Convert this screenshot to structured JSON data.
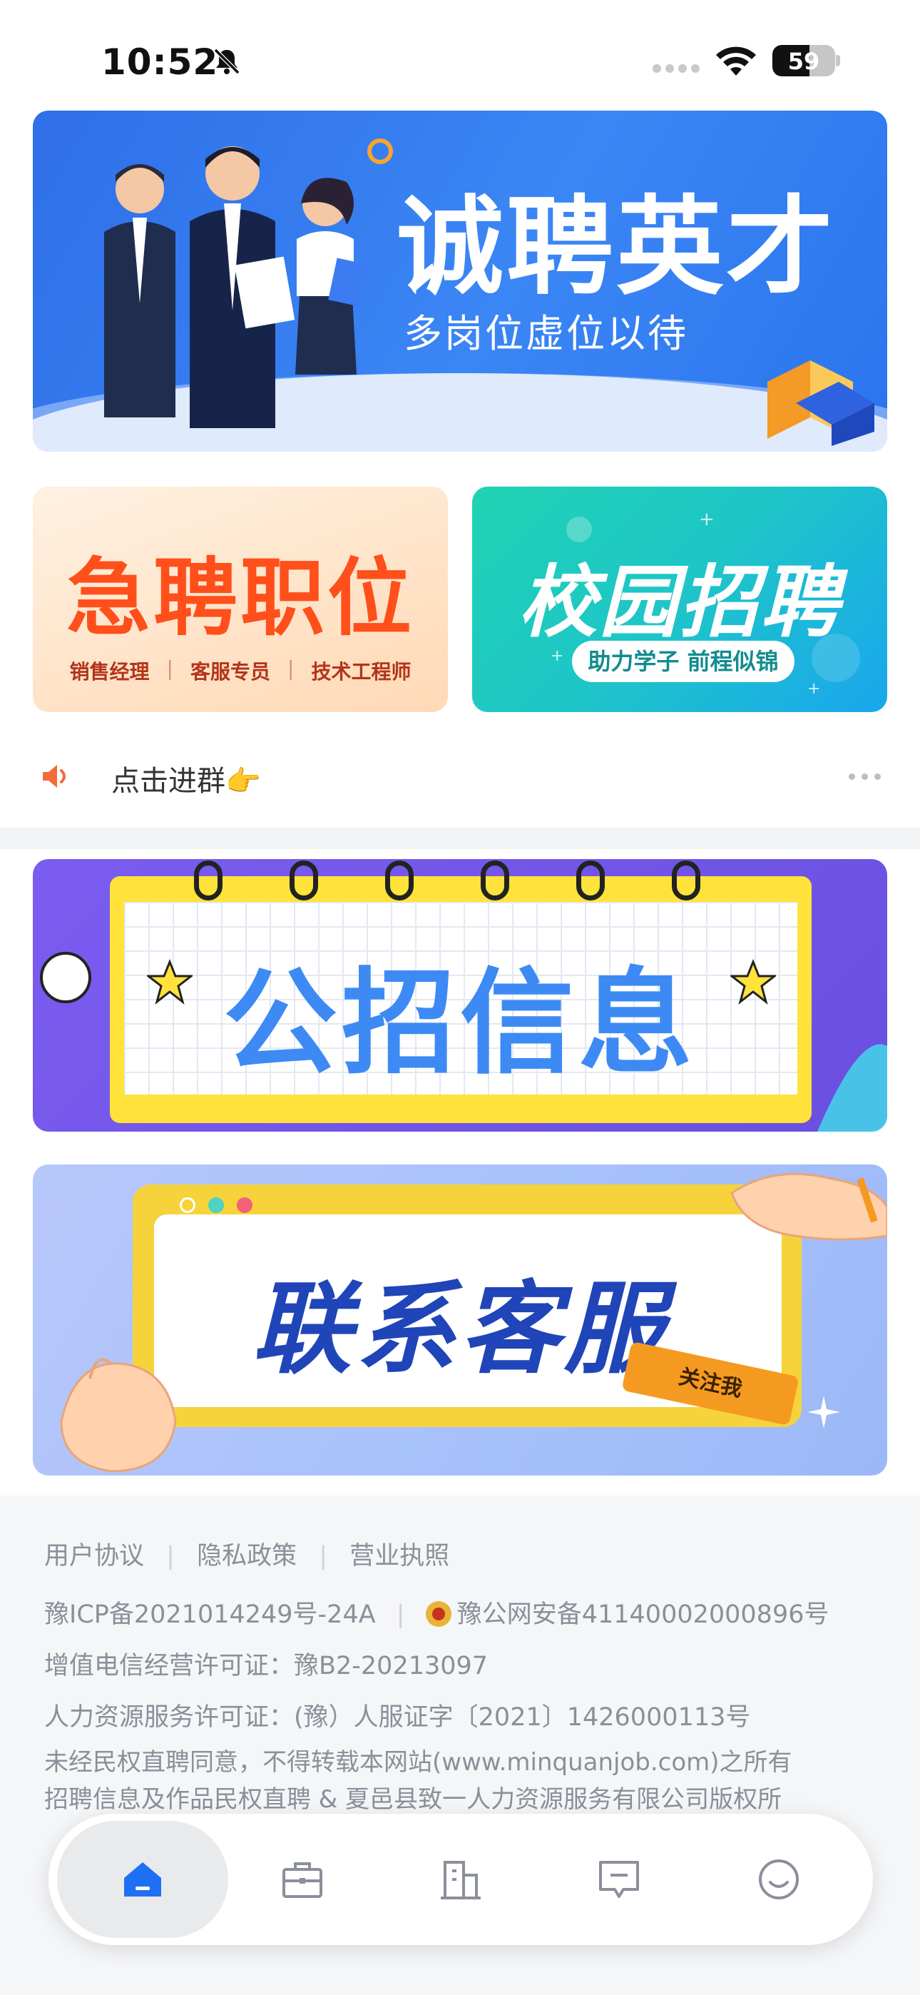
{
  "status_bar": {
    "time": "10:52",
    "battery": "59",
    "battery_level": 0.59
  },
  "banners": {
    "hero": {
      "title": "诚聘英才",
      "subtitle": "多岗位虚位以待"
    },
    "urgent": {
      "title": "急聘职位",
      "tags": [
        "销售经理",
        "客服专员",
        "技术工程师"
      ]
    },
    "campus": {
      "title": "校园招聘",
      "pill": "助力学子 前程似锦"
    },
    "public": {
      "title": "公招信息"
    },
    "service": {
      "title": "联系客服",
      "tag": "关注我"
    }
  },
  "notice": {
    "text": "点击进群👉"
  },
  "footer": {
    "links": [
      "用户协议",
      "隐私政策",
      "营业执照"
    ],
    "icp": "豫ICP备2021014249号-24A",
    "police": "豫公网安备41140002000896号",
    "telecom": "增值电信经营许可证：豫B2-20213097",
    "hr_license": "人力资源服务许可证：(豫）人服证字〔2021〕1426000113号",
    "copyright_1": "未经民权直聘同意，不得转载本网站(www.minquanjob.com)之所有",
    "copyright_2": "招聘信息及作品民权直聘 & 夏邑县致一人力资源服务有限公司版权所"
  },
  "tabbar": {
    "tabs": [
      {
        "icon": "home-icon",
        "active": true
      },
      {
        "icon": "briefcase-icon",
        "active": false
      },
      {
        "icon": "building-icon",
        "active": false
      },
      {
        "icon": "message-icon",
        "active": false
      },
      {
        "icon": "smiley-icon",
        "active": false
      }
    ]
  },
  "colors": {
    "accent": "#1f6ff5",
    "urgent": "#ff4f1a",
    "campus": "#1ec5c8"
  }
}
